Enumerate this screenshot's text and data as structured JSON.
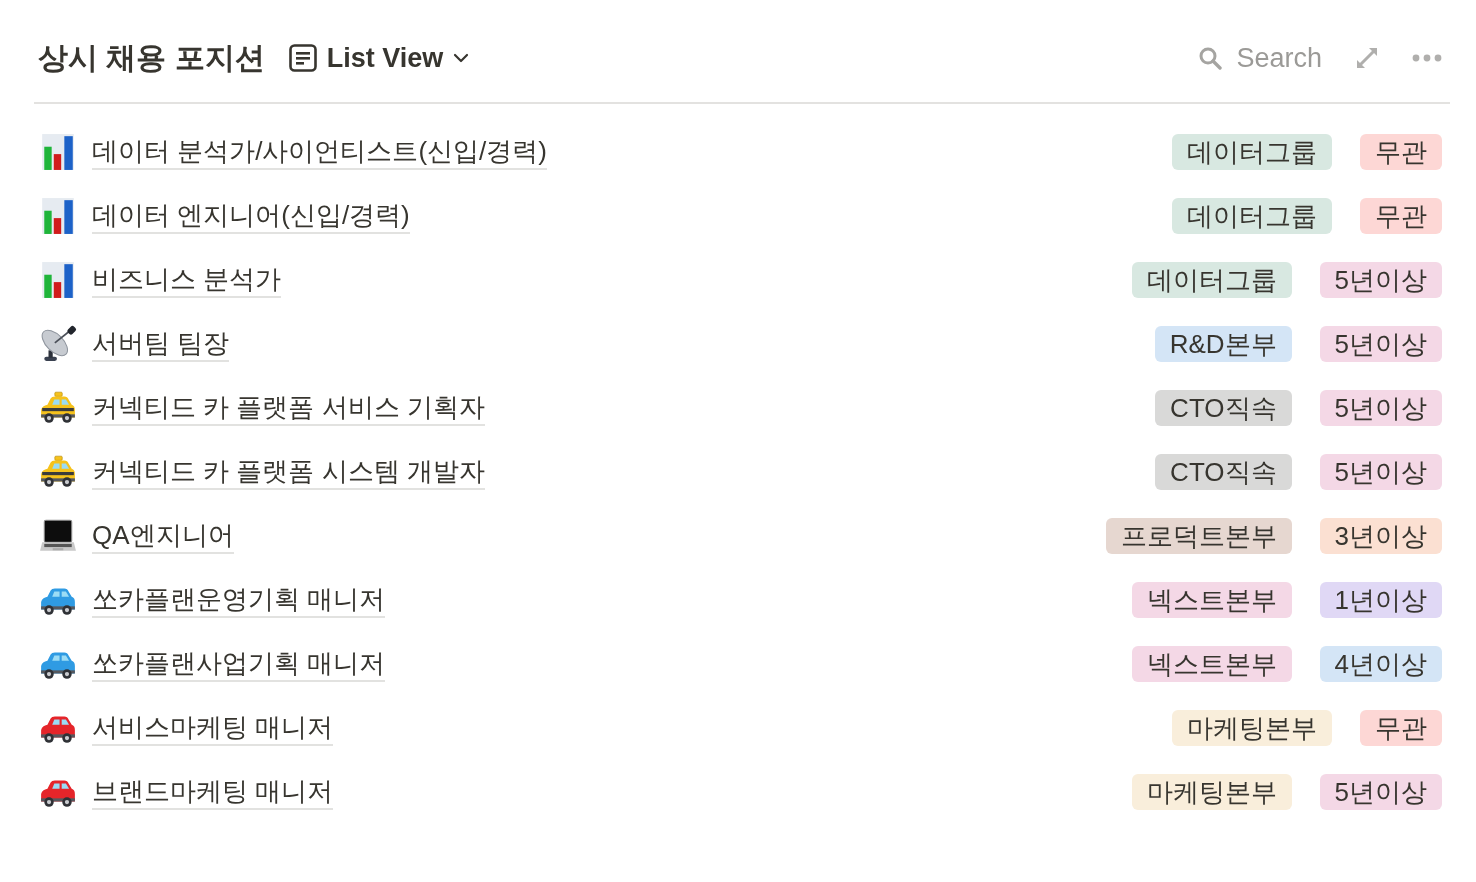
{
  "header": {
    "title": "상시 채용 포지션",
    "view": {
      "label": "List View"
    },
    "search": {
      "label": "Search"
    }
  },
  "rows": [
    {
      "kind": "chart",
      "title": "데이터 분석가/사이언티스트(신입/경력)",
      "tags": [
        {
          "label": "데이터그룹",
          "color": "#d8e8e1"
        },
        {
          "label": "무관",
          "color": "#fdd7d5"
        }
      ]
    },
    {
      "kind": "chart",
      "title": "데이터 엔지니어(신입/경력)",
      "tags": [
        {
          "label": "데이터그룹",
          "color": "#d8e8e1"
        },
        {
          "label": "무관",
          "color": "#fdd7d5"
        }
      ]
    },
    {
      "kind": "chart",
      "title": "비즈니스 분석가",
      "tags": [
        {
          "label": "데이터그룹",
          "color": "#d8e8e1"
        },
        {
          "label": "5년이상",
          "color": "#f4d8e6"
        }
      ]
    },
    {
      "kind": "satellite",
      "title": "서버팀 팀장",
      "tags": [
        {
          "label": "R&D본부",
          "color": "#d4e5f6"
        },
        {
          "label": "5년이상",
          "color": "#f4d8e6"
        }
      ]
    },
    {
      "kind": "taxi",
      "title": "커넥티드 카 플랫폼 서비스 기획자",
      "tags": [
        {
          "label": "CTO직속",
          "color": "#d9d9d8"
        },
        {
          "label": "5년이상",
          "color": "#f4d8e6"
        }
      ]
    },
    {
      "kind": "taxi",
      "title": "커넥티드 카 플랫폼 시스템 개발자",
      "tags": [
        {
          "label": "CTO직속",
          "color": "#d9d9d8"
        },
        {
          "label": "5년이상",
          "color": "#f4d8e6"
        }
      ]
    },
    {
      "kind": "laptop",
      "title": "QA엔지니어",
      "tags": [
        {
          "label": "프로덕트본부",
          "color": "#e6d7d0"
        },
        {
          "label": "3년이상",
          "color": "#fbe0d2"
        }
      ]
    },
    {
      "kind": "suv",
      "title": "쏘카플랜운영기획 매니저",
      "tags": [
        {
          "label": "넥스트본부",
          "color": "#f4d8e6"
        },
        {
          "label": "1년이상",
          "color": "#e0d8f5"
        }
      ]
    },
    {
      "kind": "suv",
      "title": "쏘카플랜사업기획 매니저",
      "tags": [
        {
          "label": "넥스트본부",
          "color": "#f4d8e6"
        },
        {
          "label": "4년이상",
          "color": "#d4e5f6"
        }
      ]
    },
    {
      "kind": "car",
      "title": "서비스마케팅 매니저",
      "tags": [
        {
          "label": "마케팅본부",
          "color": "#f9eedb"
        },
        {
          "label": "무관",
          "color": "#fdd7d5"
        }
      ]
    },
    {
      "kind": "car",
      "title": "브랜드마케팅 매니저",
      "tags": [
        {
          "label": "마케팅본부",
          "color": "#f9eedb"
        },
        {
          "label": "5년이상",
          "color": "#f4d8e6"
        }
      ]
    }
  ]
}
